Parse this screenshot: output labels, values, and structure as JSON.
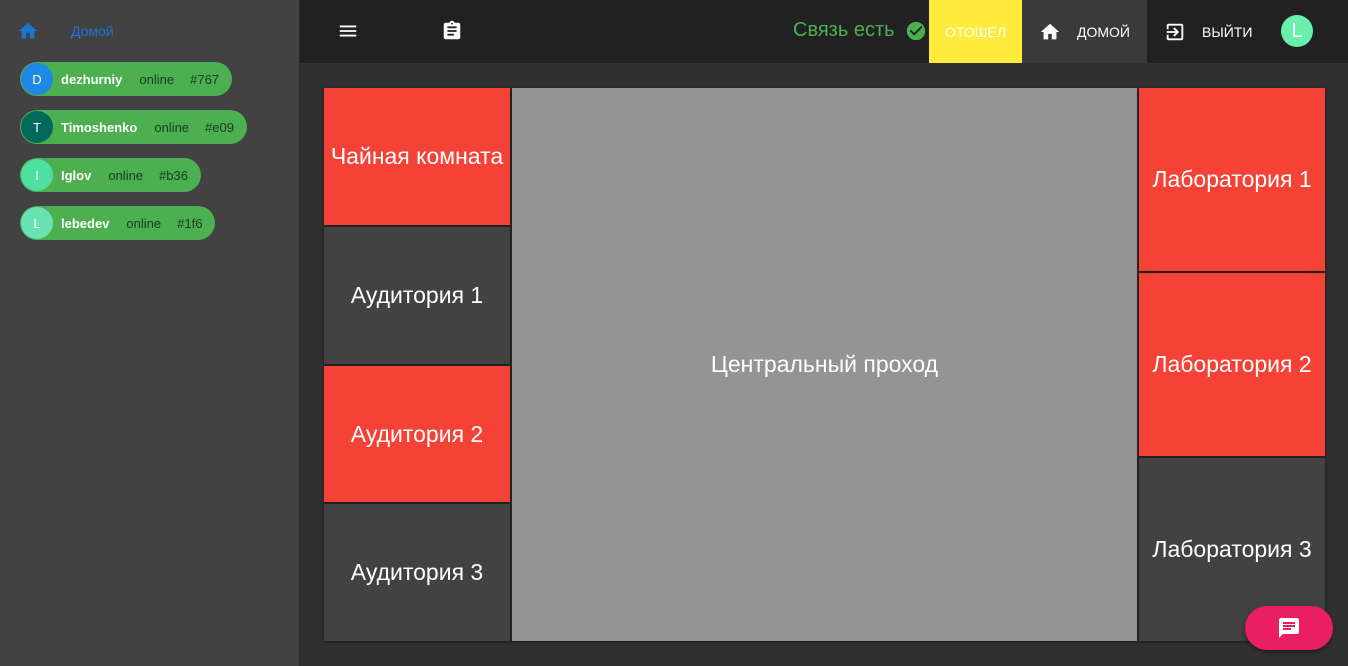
{
  "sidebar": {
    "home_label": "Домой",
    "users": [
      {
        "initial": "D",
        "name": "dezhurniy",
        "status": "online",
        "code": "#767",
        "avatar_color": "#1e88e5"
      },
      {
        "initial": "T",
        "name": "Timoshenko",
        "status": "online",
        "code": "#e09",
        "avatar_color": "#00695c"
      },
      {
        "initial": "I",
        "name": "Iglov",
        "status": "online",
        "code": "#b36",
        "avatar_color": "#4ee0a0"
      },
      {
        "initial": "L",
        "name": "lebedev",
        "status": "online",
        "code": "#1f6",
        "avatar_color": "#69e3b4"
      }
    ]
  },
  "topbar": {
    "connection_label": "Связь есть",
    "away_label": "ОТОШЕЛ",
    "home_label": "ДОМОЙ",
    "exit_label": "ВЫЙТИ",
    "avatar_initial": "L"
  },
  "rooms": {
    "tea_room": "Чайная комната",
    "auditorium_1": "Аудитория 1",
    "auditorium_2": "Аудитория 2",
    "auditorium_3": "Аудитория 3",
    "central_hall": "Центральный проход",
    "lab_1": "Лаборатория 1",
    "lab_2": "Лаборатория 2",
    "lab_3": "Лаборатория 3"
  },
  "colors": {
    "busy": "#f44336",
    "free": "#424242",
    "hall": "#949494",
    "online": "#4caf50",
    "away": "#ffeb3b",
    "accent": "#e91e63"
  },
  "icons": [
    "home-icon",
    "menu-icon",
    "clipboard-icon",
    "check-circle-icon",
    "exit-icon",
    "chat-icon"
  ]
}
